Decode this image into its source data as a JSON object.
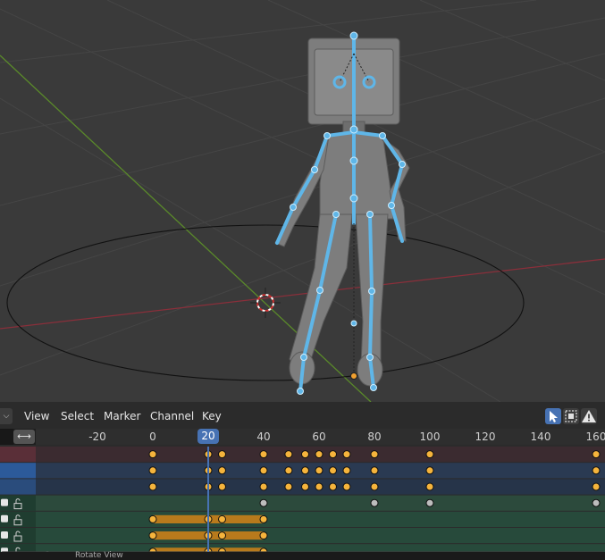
{
  "header": {
    "editor_type_icon": "chevron-down-icon",
    "menus": [
      "View",
      "Select",
      "Marker",
      "Channel",
      "Key"
    ],
    "tools": [
      "select-tweak-icon",
      "select-box-icon",
      "warning-icon"
    ]
  },
  "ruler": {
    "toggle_label": "⟷",
    "ticks": [
      "-20",
      "0",
      "40",
      "60",
      "80",
      "100",
      "120",
      "140",
      "160"
    ],
    "current_frame": "20"
  },
  "timeline": {
    "frame_min": -40,
    "frame_max": 163,
    "current_frame": 20,
    "keyframe_rows": [
      {
        "type": "summary",
        "frames": [
          0,
          20,
          25,
          40,
          49,
          55,
          60,
          65,
          70,
          80,
          100,
          160
        ]
      },
      {
        "type": "summary",
        "frames": [
          0,
          20,
          25,
          40,
          49,
          55,
          60,
          65,
          70,
          80,
          100,
          160
        ]
      },
      {
        "type": "summary",
        "frames": [
          0,
          20,
          25,
          40,
          49,
          55,
          60,
          65,
          70,
          80,
          100,
          160
        ]
      },
      {
        "type": "group",
        "frames": [
          40,
          80,
          100,
          160
        ]
      },
      {
        "type": "channel",
        "frames": [
          0,
          20,
          25,
          40
        ],
        "hold": [
          0,
          40
        ]
      },
      {
        "type": "channel",
        "frames": [
          0,
          20,
          25,
          40
        ],
        "hold": [
          0,
          40
        ]
      },
      {
        "type": "channel",
        "frames": [
          0,
          20,
          25,
          40
        ],
        "hold": [
          0,
          40
        ]
      }
    ]
  },
  "colors": {
    "keyframe_selected": "#f5b43c",
    "keyframe_unselected": "#bdbdbd",
    "hold_bar": "#b87a1c",
    "playhead": "#4772b3",
    "armature": "#5fb6e8",
    "x_axis": "#8a2f3a",
    "y_axis": "#5a8a2a"
  },
  "status": {
    "text": "Rotate View"
  }
}
